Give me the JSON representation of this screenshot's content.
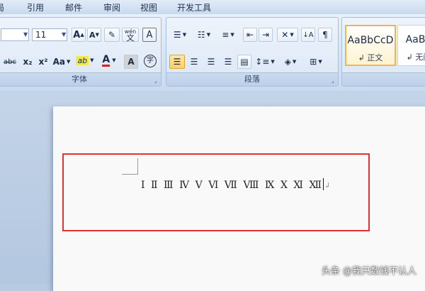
{
  "menu": {
    "items": [
      "局",
      "引用",
      "邮件",
      "审阅",
      "视图",
      "开发工具"
    ]
  },
  "ribbon": {
    "font_group": {
      "label": "字体",
      "font_name_value": "",
      "font_size_value": "11",
      "grow_font": "A",
      "shrink_font": "A",
      "clear_format": "✎",
      "phonetic": "wén",
      "char_border": "A",
      "strikethrough": "abc",
      "subscript": "x₂",
      "superscript": "x²",
      "change_case": "Aa",
      "highlight": "ab",
      "font_color": "A",
      "char_shading": "A",
      "enclose_char": "字",
      "highlight_color": "#f4e84a",
      "font_color_bar": "#e0201b"
    },
    "paragraph_group": {
      "label": "段落"
    },
    "styles_group": {
      "items": [
        {
          "sample": "AaBbCcD",
          "name": "↲ 正文"
        },
        {
          "sample": "AaBb",
          "name": "↲ 无间"
        }
      ]
    }
  },
  "document": {
    "numerals": [
      "Ⅰ",
      "Ⅱ",
      "Ⅲ",
      "Ⅳ",
      "Ⅴ",
      "Ⅵ",
      "Ⅶ",
      "Ⅷ",
      "Ⅸ",
      "Ⅹ",
      "Ⅺ",
      "Ⅻ"
    ],
    "paragraph_mark": "↲",
    "highlight_color": "#e03434"
  },
  "watermark": "头条 @我只数钱不认人"
}
